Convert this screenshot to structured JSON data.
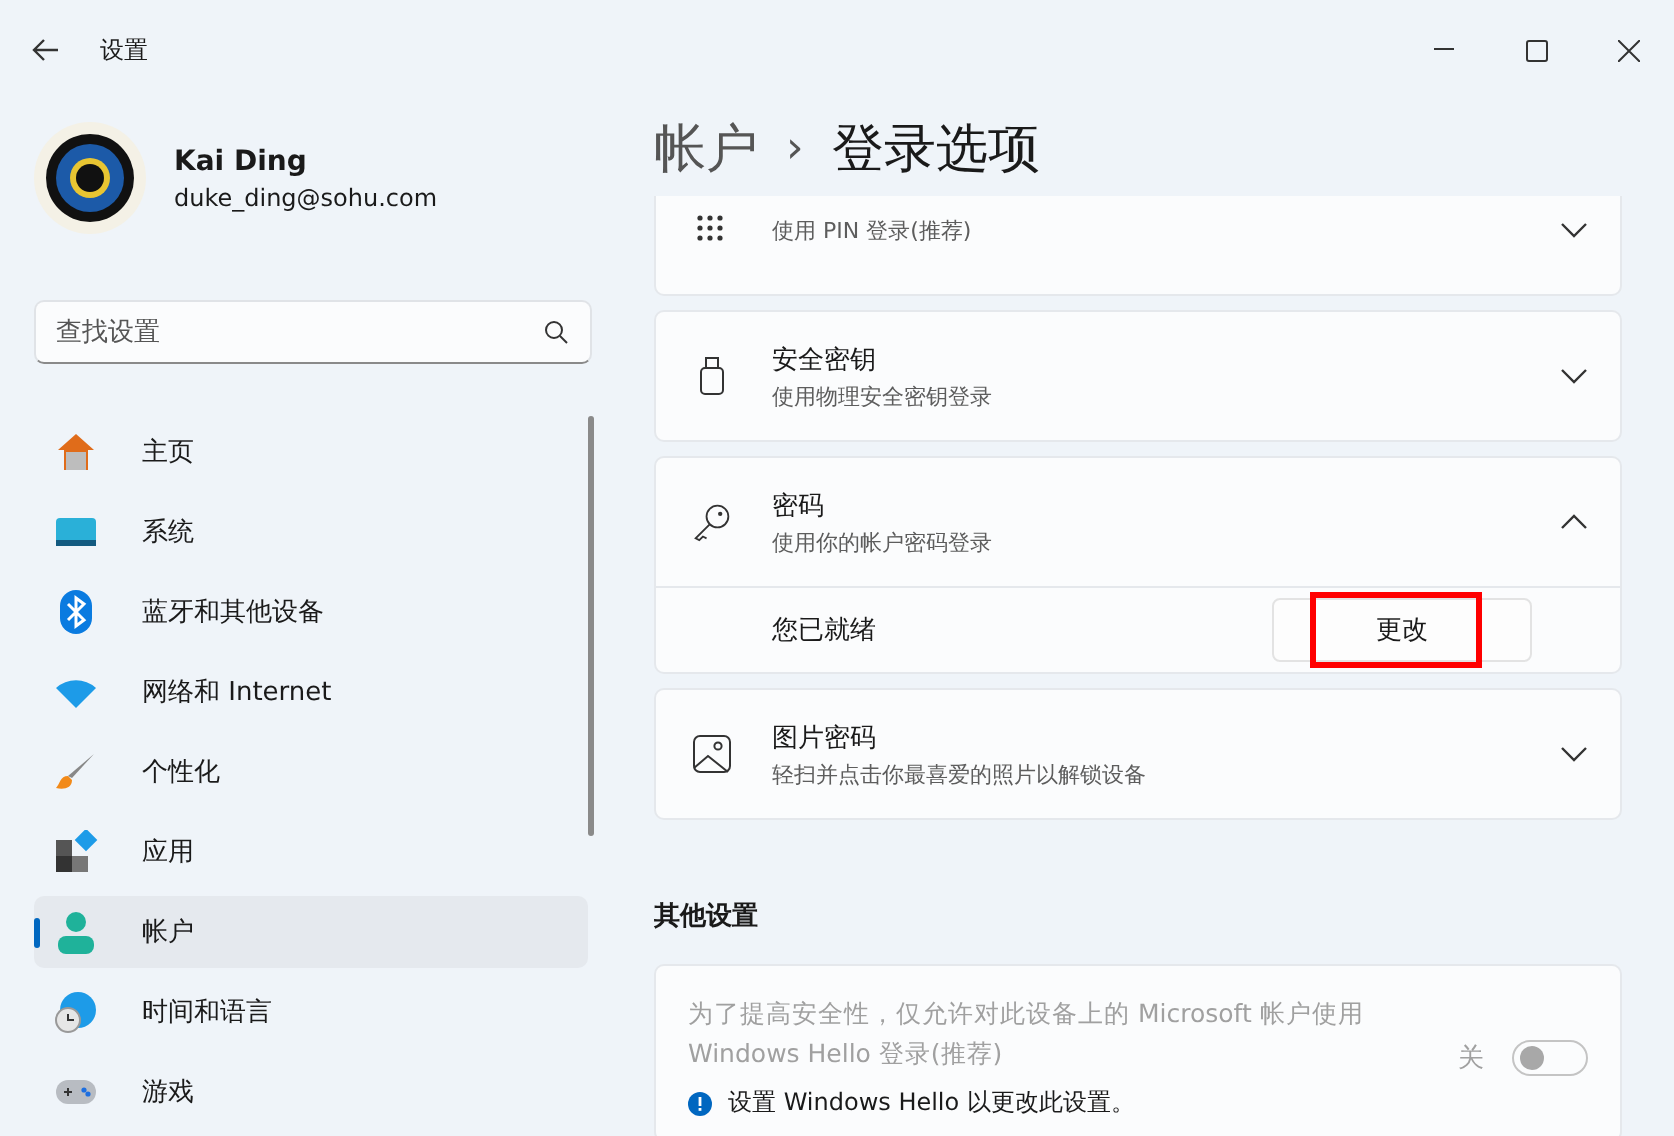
{
  "window": {
    "title": "设置"
  },
  "user": {
    "name": "Kai Ding",
    "email": "duke_ding@sohu.com"
  },
  "search": {
    "placeholder": "查找设置"
  },
  "sidebar": {
    "items": [
      {
        "label": "主页",
        "selected": false
      },
      {
        "label": "系统",
        "selected": false
      },
      {
        "label": "蓝牙和其他设备",
        "selected": false
      },
      {
        "label": "网络和 Internet",
        "selected": false
      },
      {
        "label": "个性化",
        "selected": false
      },
      {
        "label": "应用",
        "selected": false
      },
      {
        "label": "帐户",
        "selected": true
      },
      {
        "label": "时间和语言",
        "selected": false
      },
      {
        "label": "游戏",
        "selected": false
      }
    ]
  },
  "breadcrumb": {
    "parent": "帐户",
    "separator": "›",
    "current": "登录选项"
  },
  "sign_in_options": [
    {
      "subtitle": "使用 PIN 登录(推荐)",
      "expanded": false
    },
    {
      "title": "安全密钥",
      "subtitle": "使用物理安全密钥登录",
      "expanded": false
    },
    {
      "title": "密码",
      "subtitle": "使用你的帐户密码登录",
      "expanded": true,
      "detail": {
        "status": "您已就绪",
        "button": "更改",
        "highlighted": true
      }
    },
    {
      "title": "图片密码",
      "subtitle": "轻扫并点击你最喜爱的照片以解锁设备",
      "expanded": false
    }
  ],
  "other_settings": {
    "heading": "其他设置",
    "setting": {
      "text": "为了提高安全性，仅允许对此设备上的 Microsoft 帐户使用 Windows Hello 登录(推荐)",
      "disabled": true,
      "state_label": "关",
      "on": false,
      "info": "设置 Windows Hello 以更改此设置。"
    }
  }
}
